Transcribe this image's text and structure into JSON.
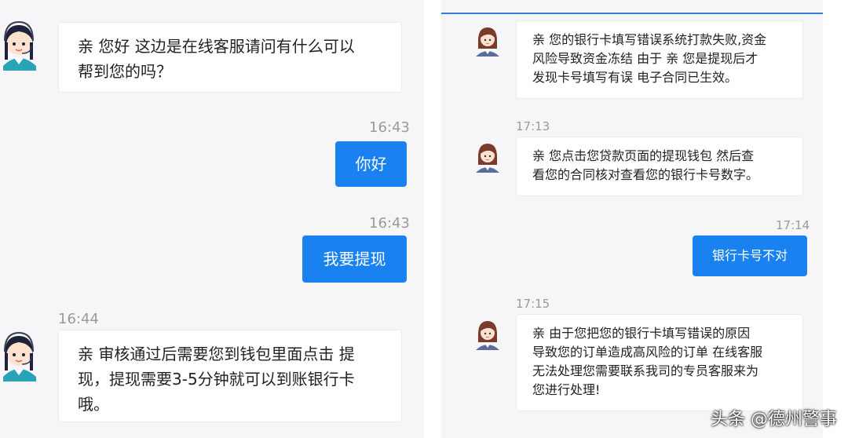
{
  "left_chat": {
    "messages": [
      {
        "text": "亲 您好 这边是在线客服请问有什么可以\n帮到您的吗？"
      },
      {
        "time": "16:43",
        "text": "你好"
      },
      {
        "time": "16:43",
        "text": "我要提现"
      },
      {
        "time": "16:44",
        "text": "亲 审核通过后需要您到钱包里面点击 提\n现，提现需要3-5分钟就可以到账银行卡\n哦。"
      }
    ]
  },
  "right_chat": {
    "messages": [
      {
        "text": "亲 您的银行卡填写错误系统打款失败,资金\n风险导致资金冻结 由于 亲 您是提现后才\n发现卡号填写有误 电子合同已生效。"
      },
      {
        "time": "17:13",
        "text": "亲 您点击您贷款页面的提现钱包 然后查\n看您的合同核对查看您的银行卡号数字。"
      },
      {
        "time": "17:14",
        "text": "银行卡号不对"
      },
      {
        "time": "17:15",
        "text": "亲 由于您把您的银行卡填写错误的原因\n导致您的订单造成高风险的订单 在线客服\n无法处理您需要联系我司的专员客服来为\n您进行处理!"
      }
    ]
  },
  "watermark": "头条 @德州警事",
  "colors": {
    "accent": "#1a82f0",
    "bubble_bg": "#ffffff",
    "chat_bg": "#f6f6f8",
    "timestamp": "#9a9a9a"
  },
  "icons": {
    "agent_avatar_left": "agent-headset-avatar",
    "agent_avatar_right": "agent-female-avatar"
  }
}
